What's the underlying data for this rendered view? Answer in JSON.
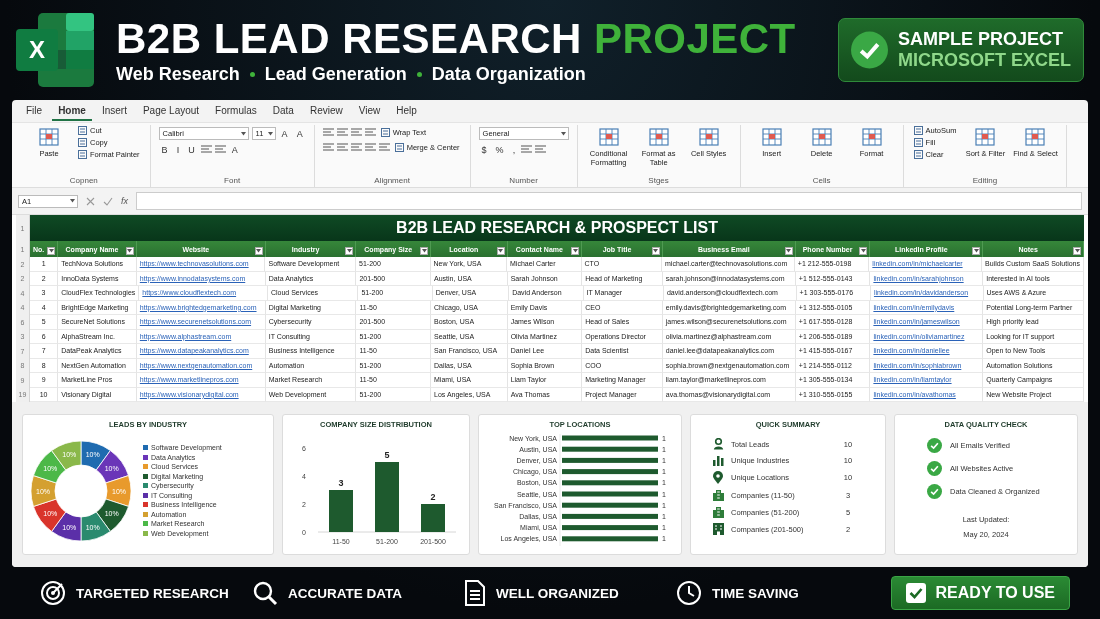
{
  "banner": {
    "logo_letter": "X",
    "title": "B2B LEAD RESEARCH",
    "title_accent": "PROJECT",
    "subtitles": [
      "Web Research",
      "Lead Generation",
      "Data Organization"
    ],
    "badge": {
      "line_1": "SAMPLE PROJECT",
      "line_2": "MICROSOFT EXCEL"
    }
  },
  "menu_tabs": [
    {
      "label": "File",
      "selected": false
    },
    {
      "label": "Home",
      "selected": true
    },
    {
      "label": "Insert",
      "selected": false
    },
    {
      "label": "Page Layout",
      "selected": false
    },
    {
      "label": "Formulas",
      "selected": false
    },
    {
      "label": "Data",
      "selected": false
    },
    {
      "label": "Review",
      "selected": false
    },
    {
      "label": "View",
      "selected": false
    },
    {
      "label": "Help",
      "selected": false
    }
  ],
  "ribbon_groups": [
    {
      "label": "Copnen",
      "items": [
        {
          "kind": "large",
          "label": "Paste"
        },
        {
          "kind": "small",
          "label": "Cut"
        },
        {
          "kind": "small",
          "label": "Copy"
        },
        {
          "kind": "small",
          "label": "Format Painter"
        }
      ]
    },
    {
      "label": "Font",
      "tool_rows": [
        {
          "items": [
            {
              "kind": "field",
              "value": "Calibri"
            },
            {
              "kind": "field",
              "value": "11"
            },
            {
              "kind": "glyph",
              "label": "A"
            },
            {
              "kind": "glyph",
              "label": "A"
            }
          ]
        },
        {
          "items": [
            {
              "kind": "glyph",
              "label": "B"
            },
            {
              "kind": "glyph",
              "label": "I"
            },
            {
              "kind": "glyph",
              "label": "U"
            },
            {
              "kind": "icon"
            },
            {
              "kind": "icon"
            },
            {
              "kind": "glyph",
              "label": "A"
            }
          ]
        }
      ]
    },
    {
      "label": "Alignment",
      "tool_rows": [
        {
          "items": [
            {
              "kind": "icon"
            },
            {
              "kind": "icon"
            },
            {
              "kind": "icon"
            },
            {
              "kind": "icon"
            },
            {
              "kind": "small",
              "label": "Wrap Text"
            }
          ]
        },
        {
          "items": [
            {
              "kind": "icon"
            },
            {
              "kind": "icon"
            },
            {
              "kind": "icon"
            },
            {
              "kind": "icon"
            },
            {
              "kind": "icon"
            },
            {
              "kind": "small",
              "label": "Merge & Center"
            }
          ]
        }
      ]
    },
    {
      "label": "Number",
      "tool_rows": [
        {
          "items": [
            {
              "kind": "field",
              "value": "General"
            }
          ]
        },
        {
          "items": [
            {
              "kind": "glyph",
              "label": "$"
            },
            {
              "kind": "glyph",
              "label": "%"
            },
            {
              "kind": "glyph",
              "label": ","
            },
            {
              "kind": "icon"
            },
            {
              "kind": "icon"
            }
          ]
        }
      ]
    },
    {
      "label": "Stges",
      "items": [
        {
          "kind": "large",
          "label": "Conditional Formatting"
        },
        {
          "kind": "large",
          "label": "Format as Table"
        },
        {
          "kind": "large",
          "label": "Cell Styles"
        }
      ]
    },
    {
      "label": "Cells",
      "items": [
        {
          "kind": "large",
          "label": "Insert"
        },
        {
          "kind": "large",
          "label": "Delete"
        },
        {
          "kind": "large",
          "label": "Format"
        }
      ]
    },
    {
      "label": "Editing",
      "items": [
        {
          "kind": "small",
          "label": "AutoSum"
        },
        {
          "kind": "small",
          "label": "Fill"
        },
        {
          "kind": "small",
          "label": "Clear"
        },
        {
          "kind": "large",
          "label": "Sort & Filter"
        },
        {
          "kind": "large",
          "label": "Find & Select"
        }
      ]
    }
  ],
  "formula_bar": {
    "name_box": "A1",
    "function_label": "fx"
  },
  "sheet": {
    "title_row_number": "1",
    "title": "B2B LEAD RESEARCH & PROSPECT LIST",
    "header_row_number": "1",
    "columns": [
      {
        "label": "No.",
        "kind": "center"
      },
      {
        "label": "Company Name",
        "kind": "text"
      },
      {
        "label": "Website",
        "kind": "link"
      },
      {
        "label": "Industry",
        "kind": "text"
      },
      {
        "label": "Company Size",
        "kind": "text"
      },
      {
        "label": "Location",
        "kind": "text"
      },
      {
        "label": "Contact Name",
        "kind": "text"
      },
      {
        "label": "Job Title",
        "kind": "text"
      },
      {
        "label": "Business Email",
        "kind": "text"
      },
      {
        "label": "Phone Number",
        "kind": "text"
      },
      {
        "label": "LinkedIn Profile",
        "kind": "link"
      },
      {
        "label": "Notes",
        "kind": "text"
      }
    ],
    "rows": [
      {
        "row_number": "2",
        "cells": [
          "1",
          "TechNova Solutions",
          "https://www.technovasolutions.com",
          "Software Development",
          "51-200",
          "New York, USA",
          "Michael Carter",
          "CTO",
          "michael.carter@technovasolutions.com",
          "+1 212-555-0198",
          "linkedin.com/in/michaelcarter",
          "Builds Custom SaaS Solutions"
        ]
      },
      {
        "row_number": "2",
        "cells": [
          "2",
          "InnoData Systems",
          "https://www.innodatasystems.com",
          "Data Analytics",
          "201-500",
          "Austin, USA",
          "Sarah Johnson",
          "Head of Marketing",
          "sarah.johnson@innodatasystems.com",
          "+1 512-555-0143",
          "linkedin.com/in/sarahjohnson",
          "Interested in AI tools"
        ]
      },
      {
        "row_number": "4",
        "cells": [
          "3",
          "CloudFlex Technologies",
          "https://www.cloudflextech.com",
          "Cloud Services",
          "51-200",
          "Denver, USA",
          "David Anderson",
          "IT Manager",
          "david.anderson@cloudflextech.com",
          "+1 303-555-0176",
          "linkedin.com/in/davidanderson",
          "Uses AWS & Azure"
        ]
      },
      {
        "row_number": "4",
        "cells": [
          "4",
          "BrightEdge Marketing",
          "https://www.brightedgemarketing.com",
          "Digital Marketing",
          "11-50",
          "Chicago, USA",
          "Emily Davis",
          "CEO",
          "emily.davis@brightedgemarketing.com",
          "+1 312-555-0105",
          "linkedin.com/in/emilydavis",
          "Potential Long-term Partner"
        ]
      },
      {
        "row_number": "6",
        "cells": [
          "5",
          "SecureNet Solutions",
          "https://www.securenetsolutions.com",
          "Cybersecurity",
          "201-500",
          "Boston, USA",
          "James Wilson",
          "Head of Sales",
          "james.wilson@securenetsolutions.com",
          "+1 617-555-0128",
          "linkedin.com/in/jameswilson",
          "High priority lead"
        ]
      },
      {
        "row_number": "3",
        "cells": [
          "6",
          "AlphaStream Inc.",
          "https://www.alphastream.com",
          "IT Consulting",
          "51-200",
          "Seattle, USA",
          "Olivia Martinez",
          "Operations Director",
          "olivia.martinez@alphastream.com",
          "+1 206-555-0189",
          "linkedin.com/in/oliviamartinez",
          "Looking for IT support"
        ]
      },
      {
        "row_number": "7",
        "cells": [
          "7",
          "DataPeak Analytics",
          "https://www.datapeakanalytics.com",
          "Business Intelligence",
          "11-50",
          "San Francisco, USA",
          "Daniel Lee",
          "Data Scientist",
          "daniel.lee@datapeakanalytics.com",
          "+1 415-555-0167",
          "linkedin.com/in/daniellee",
          "Open to New Tools"
        ]
      },
      {
        "row_number": "8",
        "cells": [
          "8",
          "NextGen Automation",
          "https://www.nextgenautomation.com",
          "Automation",
          "51-200",
          "Dallas, USA",
          "Sophia Brown",
          "COO",
          "sophia.brown@nextgenautomation.com",
          "+1 214-555-0112",
          "linkedin.com/in/sophiabrown",
          "Automation Solutions"
        ]
      },
      {
        "row_number": "9",
        "cells": [
          "9",
          "MarketLine Pros",
          "https://www.marketlinepros.com",
          "Market Research",
          "11-50",
          "Miami, USA",
          "Liam Taylor",
          "Marketing Manager",
          "liam.taylor@marketlinepros.com",
          "+1 305-555-0134",
          "linkedin.com/in/liamtaylor",
          "Quarterly Campaigns"
        ]
      },
      {
        "row_number": "19",
        "cells": [
          "10",
          "Visionary Digital",
          "https://www.visionarydigital.com",
          "Web Development",
          "51-200",
          "Los Angeles, USA",
          "Ava Thomas",
          "Project Manager",
          "ava.thomas@visionarydigital.com",
          "+1 310-555-0155",
          "linkedin.com/in/avathomas",
          "New Website Project"
        ]
      }
    ]
  },
  "dashboard": {
    "industry_card": {
      "title": "LEADS BY INDUSTRY",
      "chart_data": {
        "type": "donut",
        "categories": [
          "Software Development",
          "Data Analytics",
          "Cloud Services",
          "Digital Marketing",
          "Cybersecurity",
          "IT Consulting",
          "Business Intelligence",
          "Automation",
          "Market Research",
          "Web Development"
        ],
        "series": [
          {
            "values": [
              10,
              10,
              10,
              10,
              10,
              10,
              10,
              10,
              10,
              10
            ]
          }
        ],
        "colors": [
          "#1f6bb0",
          "#6a35b8",
          "#e89a2c",
          "#1e5a2e",
          "#2a8a6e",
          "#5b2fa8",
          "#d9342b",
          "#d4a030",
          "#4cb848",
          "#8ab84a"
        ],
        "value_labels": [
          "10%",
          "10%",
          "10%",
          "10%",
          "10%",
          "10%",
          "10%",
          "10%",
          "10%",
          "10%"
        ]
      }
    },
    "size_card": {
      "title": "COMPANY SIZE DISTRIBUTION",
      "chart_data": {
        "type": "bar",
        "categories": [
          "11-50",
          "51-200",
          "201-500"
        ],
        "series": [
          {
            "color": "#1e5a2e",
            "values": [
              3,
              5,
              2
            ]
          }
        ],
        "ylim": [
          0,
          6
        ],
        "yticks": [
          0,
          2,
          4,
          6
        ],
        "data_labels": true
      }
    },
    "locations_card": {
      "title": "TOP LOCATIONS",
      "chart_data": {
        "type": "bar",
        "orientation": "horizontal",
        "categories": [
          "New York, USA",
          "Austin, USA",
          "Denver, USA",
          "Chicago, USA",
          "Boston, USA",
          "Seattle, USA",
          "San Francisco, USA",
          "Dallas, USA",
          "Miami, USA",
          "Los Angeles, USA"
        ],
        "series": [
          {
            "color": "#1e5a2e",
            "values": [
              1,
              1,
              1,
              1,
              1,
              1,
              1,
              1,
              1,
              1
            ]
          }
        ],
        "data_labels": true
      }
    },
    "summary_card": {
      "title": "QUICK SUMMARY",
      "items": [
        {
          "kind": "person",
          "label": "Total Leads",
          "value": "10"
        },
        {
          "kind": "chart",
          "label": "Unique Industries",
          "value": "10"
        },
        {
          "kind": "pin",
          "label": "Unique Locations",
          "value": "10"
        },
        {
          "kind": "building",
          "label": "Companies (11-50)",
          "value": "3"
        },
        {
          "kind": "building",
          "label": "Companies (51-200)",
          "value": "5"
        },
        {
          "kind": "office",
          "label": "Companies (201-500)",
          "value": "2"
        }
      ]
    },
    "quality_card": {
      "title": "DATA QUALITY CHECK",
      "checks": [
        {
          "label": "All Emails Verified",
          "checked": true
        },
        {
          "label": "All Websites Active",
          "checked": true
        },
        {
          "label": "Data Cleaned & Organized",
          "checked": true
        }
      ],
      "updated_label": "Last Updated:",
      "updated_date": "May 20, 2024"
    }
  },
  "footer": {
    "features": [
      {
        "kind": "target",
        "label": "TARGETED RESEARCH"
      },
      {
        "kind": "search",
        "label": "ACCURATE DATA"
      },
      {
        "kind": "document",
        "label": "WELL ORGANIZED"
      },
      {
        "kind": "clock",
        "label": "TIME SAVING"
      }
    ],
    "cta": {
      "label": "READY TO USE"
    }
  }
}
